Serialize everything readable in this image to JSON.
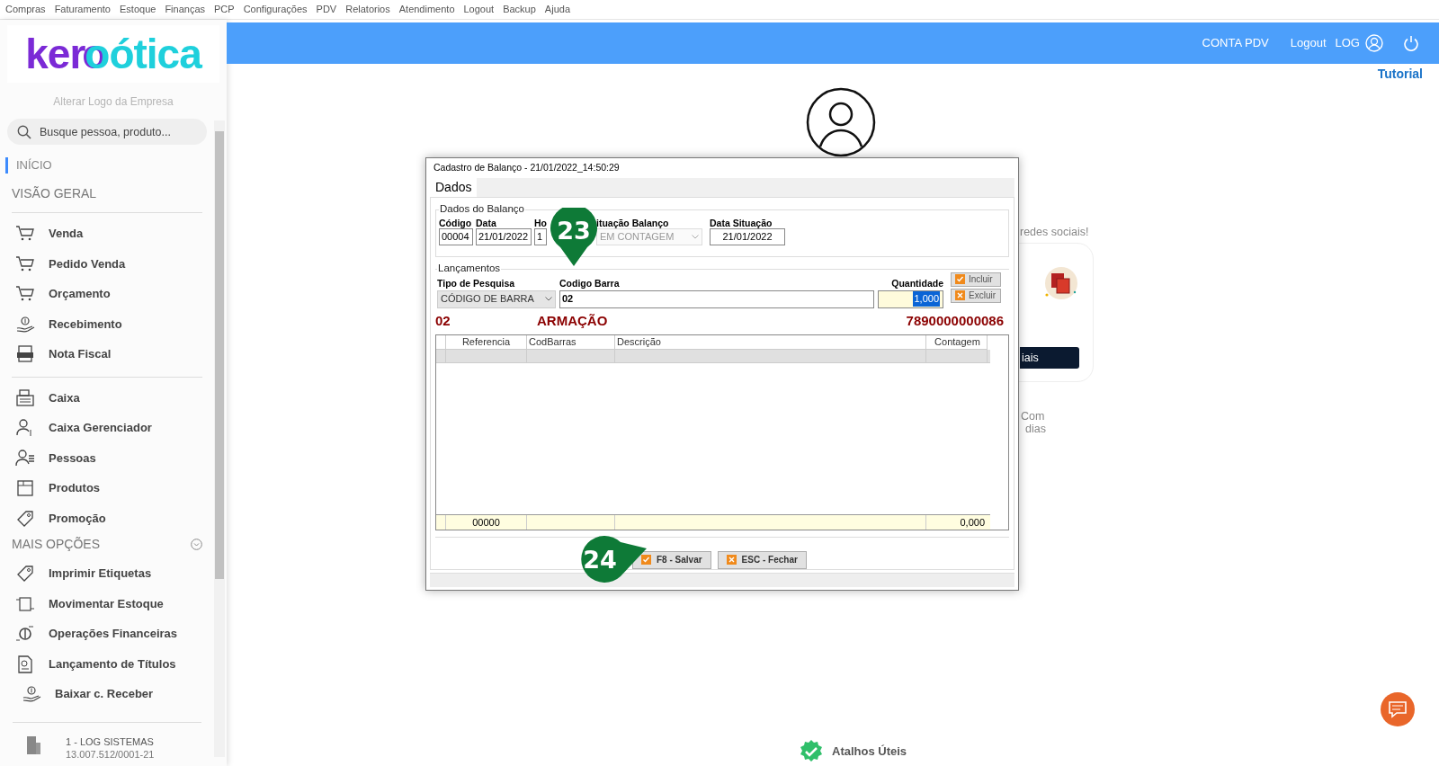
{
  "top_menu": [
    "Compras",
    "Faturamento",
    "Estoque",
    "Finanças",
    "PCP",
    "Configurações",
    "PDV",
    "Relatorios",
    "Atendimento",
    "Logout",
    "Backup",
    "Ajuda"
  ],
  "sidebar": {
    "logo_parts": [
      "ker",
      "o",
      "ótica"
    ],
    "change_logo": "Alterar Logo da Empresa",
    "search": {
      "placeholder": "Busque pessoa, produto..."
    },
    "start": {
      "label": "INÍCIO",
      "selected": true
    },
    "overview_heading": "VISÃO GERAL",
    "groups": [
      [
        "Venda",
        "Pedido Venda",
        "Orçamento",
        "Recebimento",
        "Nota Fiscal"
      ],
      [
        "Caixa",
        "Caixa Gerenciador",
        "Pessoas",
        "Produtos",
        "Promoção"
      ]
    ],
    "more_heading": "MAIS OPÇÕES",
    "more_items": [
      "Imprimir Etiquetas",
      "Movimentar Estoque",
      "Operações Financeiras",
      "Lançamento de Títulos",
      "Baixar c. Receber"
    ],
    "company": {
      "name": "1 - LOG SISTEMAS",
      "id": "13.007.512/0001-21"
    }
  },
  "header": {
    "links": [
      "CONTA PDV",
      "Logout",
      "LOG"
    ]
  },
  "tutorial": "Tutorial",
  "background": {
    "social_text": "redes sociais!",
    "card_button": "iais",
    "note_lines": [
      "Com",
      "dias"
    ],
    "shortcuts": "Atalhos Úteis"
  },
  "dialog": {
    "title": "Cadastro de Balanço - 21/01/2022_14:50:29",
    "tabs": [
      {
        "label": "Dados",
        "selected": true
      }
    ],
    "balance": {
      "legend": "Dados do Balanço",
      "fields": [
        {
          "label": "Código",
          "value": "00004",
          "kind": "text"
        },
        {
          "label": "Data",
          "value": "21/01/2022",
          "kind": "text"
        },
        {
          "label": "Ho",
          "value": "1",
          "kind": "text"
        },
        {
          "label": "ituação Balanço",
          "value": "EM CONTAGEM",
          "kind": "select"
        },
        {
          "label": "Data Situação",
          "value": "21/01/2022",
          "kind": "text"
        }
      ]
    },
    "entries": {
      "legend": "Lançamentos",
      "search_type": {
        "label": "Tipo de Pesquisa",
        "value": "CÓDIGO DE BARRA"
      },
      "barcode": {
        "label": "Codigo Barra",
        "value": "02"
      },
      "quantity": {
        "label": "Quantidade",
        "value": "1,000"
      },
      "buttons": [
        {
          "label": "Incluir",
          "kind": "check"
        },
        {
          "label": "Excluir",
          "kind": "cancel"
        }
      ]
    },
    "product": [
      "02",
      "ARMAÇÃO",
      "7890000000086"
    ],
    "grid": {
      "columns": [
        "Referencia",
        "CodBarras",
        "Descrição",
        "Contagem"
      ],
      "totals": {
        "reference": "00000",
        "count": "0,000"
      }
    },
    "buttons": [
      {
        "label": "F8 - Salvar",
        "kind": "check"
      },
      {
        "label": "ESC - Fechar",
        "kind": "cancel"
      }
    ]
  },
  "markers": [
    {
      "label": "23",
      "kind": "down"
    },
    {
      "label": "24",
      "kind": "right"
    }
  ]
}
